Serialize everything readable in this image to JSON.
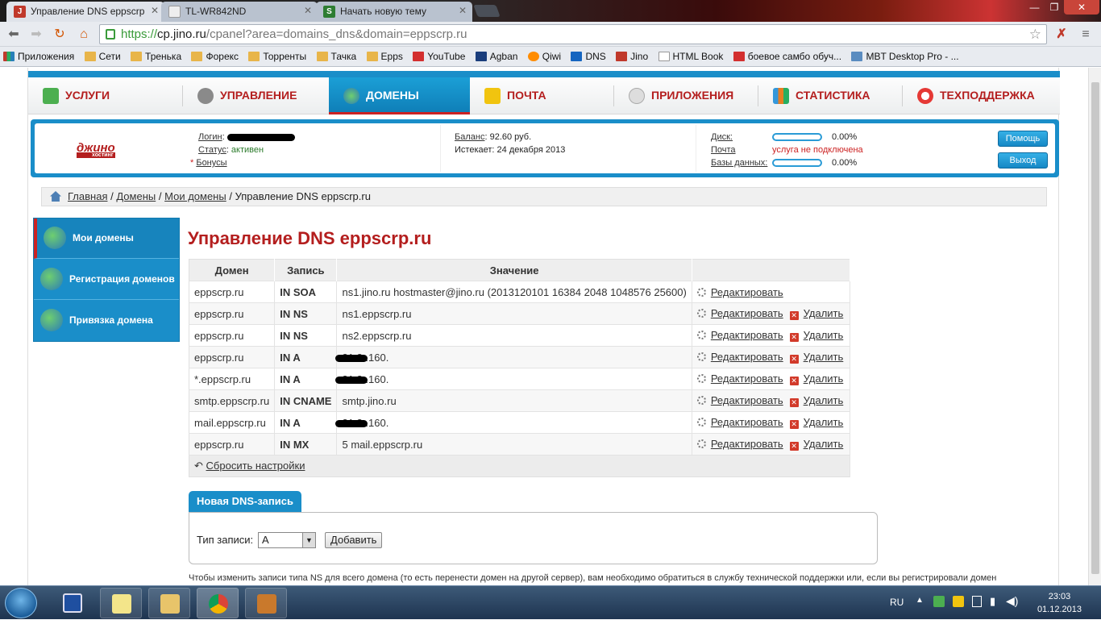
{
  "browser": {
    "tabs": [
      {
        "title": "Управление DNS eppscrp",
        "active": true,
        "icon_color": "#c0392b",
        "icon": "J"
      },
      {
        "title": "TL-WR842ND",
        "active": false,
        "icon_color": "#eeeeee",
        "icon": ""
      },
      {
        "title": "Начать новую тему",
        "active": false,
        "icon_color": "#2e7d32",
        "icon": "S"
      }
    ],
    "url": {
      "scheme": "https://",
      "host": "cp.jino.ru",
      "path": "/cpanel?area=domains_dns&domain=eppscrp.ru"
    },
    "bookmarks": [
      {
        "label": "Приложения",
        "icon_color": "#c0392b"
      },
      {
        "label": "Сети",
        "icon_color": "#e8b54a"
      },
      {
        "label": "Тренька",
        "icon_color": "#e8b54a"
      },
      {
        "label": "Форекс",
        "icon_color": "#e8b54a"
      },
      {
        "label": "Торренты",
        "icon_color": "#e8b54a"
      },
      {
        "label": "Тачка",
        "icon_color": "#e8b54a"
      },
      {
        "label": "Epps",
        "icon_color": "#e8b54a"
      },
      {
        "label": "YouTube",
        "icon_color": "#d32f2f"
      },
      {
        "label": "Agban",
        "icon_color": "#1a3d7c"
      },
      {
        "label": "Qiwi",
        "icon_color": "#ff8c00"
      },
      {
        "label": "DNS",
        "icon_color": "#1565c0"
      },
      {
        "label": "Jino",
        "icon_color": "#c0392b"
      },
      {
        "label": "HTML Book",
        "icon_color": "#ffffff"
      },
      {
        "label": "боевое самбо обуч...",
        "icon_color": "#d32f2f"
      },
      {
        "label": "MBT Desktop Pro - ...",
        "icon_color": "#5a8cc0"
      }
    ]
  },
  "menu": [
    {
      "label": "Услуги",
      "icon_color": "#4caf50",
      "active": false
    },
    {
      "label": "Управление",
      "icon_color": "#8a8a8a",
      "active": false
    },
    {
      "label": "Домены",
      "icon_color": "#2e9d5a",
      "active": true
    },
    {
      "label": "Почта",
      "icon_color": "#f1c40f",
      "active": false
    },
    {
      "label": "Приложения",
      "icon_color": "#cccccc",
      "active": false
    },
    {
      "label": "Статистика",
      "icon_color": "#e67e22",
      "active": false
    },
    {
      "label": "Техподдержка",
      "icon_color": "#e53935",
      "active": false
    }
  ],
  "account": {
    "logo_main": "джино",
    "logo_sub": "хостинг",
    "login_label": "Логин",
    "status_label": "Статус",
    "status_value": "активен",
    "bonus_label": "Бонусы",
    "balance_label": "Баланс",
    "balance_value": "92.60 руб.",
    "expires_label": "Истекает:",
    "expires_value": "24 декабря 2013",
    "disk_label": "Диск:",
    "disk_value": "0.00%",
    "mail_label": "Почта",
    "mail_value": "услуга не подключена",
    "db_label": "Базы данных:",
    "db_value": "0.00%",
    "help_button": "Помощь",
    "logout_button": "Выход"
  },
  "breadcrumb": {
    "home": "Главная",
    "domains": "Домены",
    "my_domains": "Мои домены",
    "current": "Управление DNS eppscrp.ru",
    "sep": "/"
  },
  "sidebar": [
    {
      "label": "Мои домены",
      "active": true
    },
    {
      "label": "Регистрация доменов",
      "active": false
    },
    {
      "label": "Привязка домена",
      "active": false
    }
  ],
  "page_title": "Управление DNS eppscrp.ru",
  "dns_table": {
    "headers": [
      "Домен",
      "Запись",
      "Значение",
      ""
    ],
    "edit_label": "Редактировать",
    "delete_label": "Удалить",
    "rows": [
      {
        "domain": "eppscrp.ru",
        "type": "IN SOA",
        "value": "ns1.jino.ru hostmaster@jino.ru (2013120101 16384 2048 1048576 25600)",
        "deletable": false
      },
      {
        "domain": "eppscrp.ru",
        "type": "IN NS",
        "value": "ns1.eppscrp.ru",
        "deletable": true
      },
      {
        "domain": "eppscrp.ru",
        "type": "IN NS",
        "value": "ns2.eppscrp.ru",
        "deletable": true
      },
      {
        "domain": "eppscrp.ru",
        "type": "IN A",
        "value": "31.2 .160.",
        "deletable": true
      },
      {
        "domain": "*.eppscrp.ru",
        "type": "IN A",
        "value": "31.2 .160.",
        "deletable": true
      },
      {
        "domain": "smtp.eppscrp.ru",
        "type": "IN CNAME",
        "value": "smtp.jino.ru",
        "deletable": true
      },
      {
        "domain": "mail.eppscrp.ru",
        "type": "IN A",
        "value": "31.2 .160.",
        "deletable": true
      },
      {
        "domain": "eppscrp.ru",
        "type": "IN MX",
        "value": "5 mail.eppscrp.ru",
        "deletable": true
      }
    ],
    "reset_label": "Сбросить настройки"
  },
  "new_record": {
    "tab_label": "Новая DNS-запись",
    "type_label": "Тип записи:",
    "type_value": "A",
    "add_button": "Добавить"
  },
  "note": "Чтобы изменить записи типа NS для всего домена (то есть перенести домен на другой сервер), вам необходимо обратиться в службу технической поддержки или, если вы регистрировали домен",
  "taskbar": {
    "lang": "RU",
    "time": "23:03",
    "date": "01.12.2013"
  }
}
